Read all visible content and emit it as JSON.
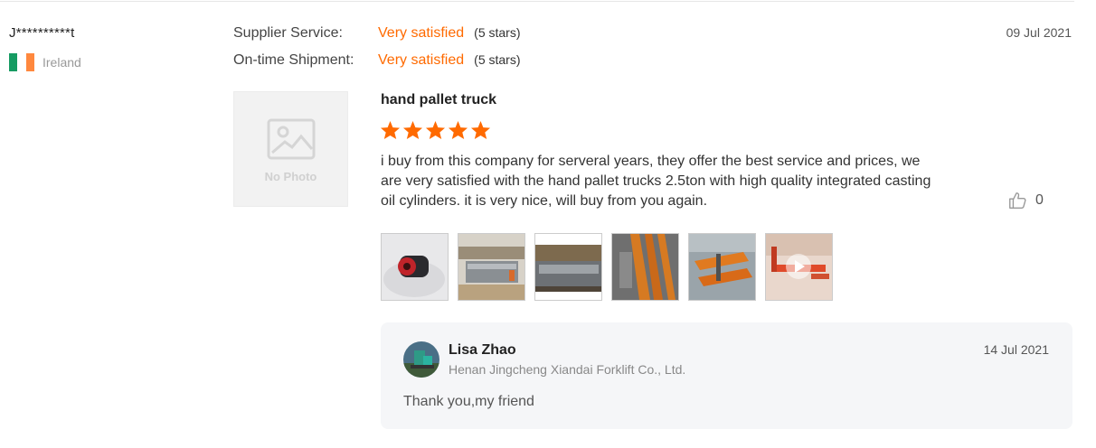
{
  "buyer": {
    "name": "J**********t",
    "country": "Ireland",
    "flag_colors": [
      "#169b62",
      "#ffffff",
      "#ff883e"
    ]
  },
  "ratings": [
    {
      "label": "Supplier Service:",
      "value": "Very satisfied",
      "stars_text": "(5 stars)"
    },
    {
      "label": "On-time Shipment:",
      "value": "Very satisfied",
      "stars_text": "(5 stars)"
    }
  ],
  "review_date": "09 Jul 2021",
  "product": {
    "image_placeholder": "No Photo",
    "title": "hand pallet truck",
    "rating": 5,
    "rating_max": 5,
    "text": "i buy from this company for serveral years, they offer the best service and prices, we are very satisfied with the hand pallet trucks 2.5ton with high quality integrated casting oil cylinders. it is very nice, will buy from you again."
  },
  "likes": {
    "count": "0"
  },
  "thumbnails": [
    {
      "name": "photo-oil-cylinder"
    },
    {
      "name": "photo-packed-trucks"
    },
    {
      "name": "photo-crate"
    },
    {
      "name": "photo-orange-forks"
    },
    {
      "name": "photo-pallet-trucks"
    },
    {
      "name": "video-pallet-truck",
      "type": "video"
    }
  ],
  "reply": {
    "name": "Lisa Zhao",
    "company": "Henan Jingcheng Xiandai Forklift Co., Ltd.",
    "date": "14 Jul 2021",
    "text": "Thank you,my friend"
  },
  "colors": {
    "accent": "#ff6a00",
    "star": "#ff6a00"
  }
}
